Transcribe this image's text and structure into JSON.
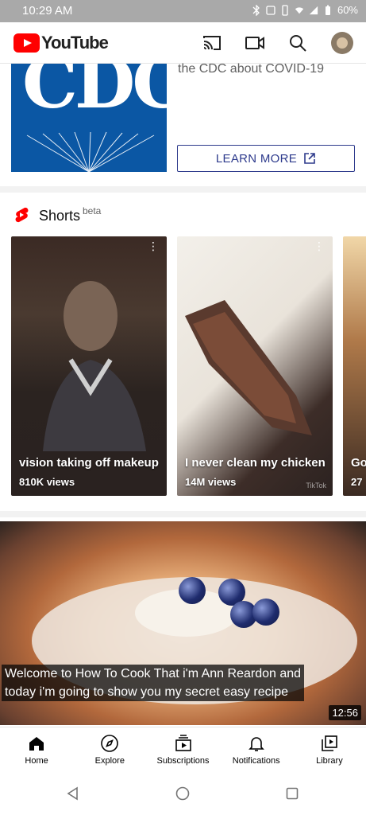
{
  "status_bar": {
    "time": "10:29 AM",
    "battery": "60%"
  },
  "app": {
    "name": "YouTube"
  },
  "promo": {
    "logo_text": "CDC",
    "text": "the CDC about COVID-19",
    "button_label": "LEARN MORE"
  },
  "shorts": {
    "title": "Shorts",
    "badge": "beta",
    "items": [
      {
        "title": "vision taking off makeup",
        "views": "810K views"
      },
      {
        "title": "I never clean my chicken",
        "views": "14M views",
        "watermark": "TikTok"
      },
      {
        "title": "Go",
        "views": "27"
      }
    ]
  },
  "video": {
    "caption_line1": "Welcome to How To Cook That i'm Ann Reardon and",
    "caption_line2": "today i'm going to show you my secret easy recipe",
    "duration": "12:56"
  },
  "bottom_nav": [
    {
      "label": "Home",
      "icon": "home-icon"
    },
    {
      "label": "Explore",
      "icon": "compass-icon"
    },
    {
      "label": "Subscriptions",
      "icon": "subscriptions-icon"
    },
    {
      "label": "Notifications",
      "icon": "bell-icon"
    },
    {
      "label": "Library",
      "icon": "library-icon"
    }
  ],
  "colors": {
    "accent": "#ff0000",
    "cdc_blue": "#0b57a4",
    "button_border": "#2d3a8c"
  }
}
